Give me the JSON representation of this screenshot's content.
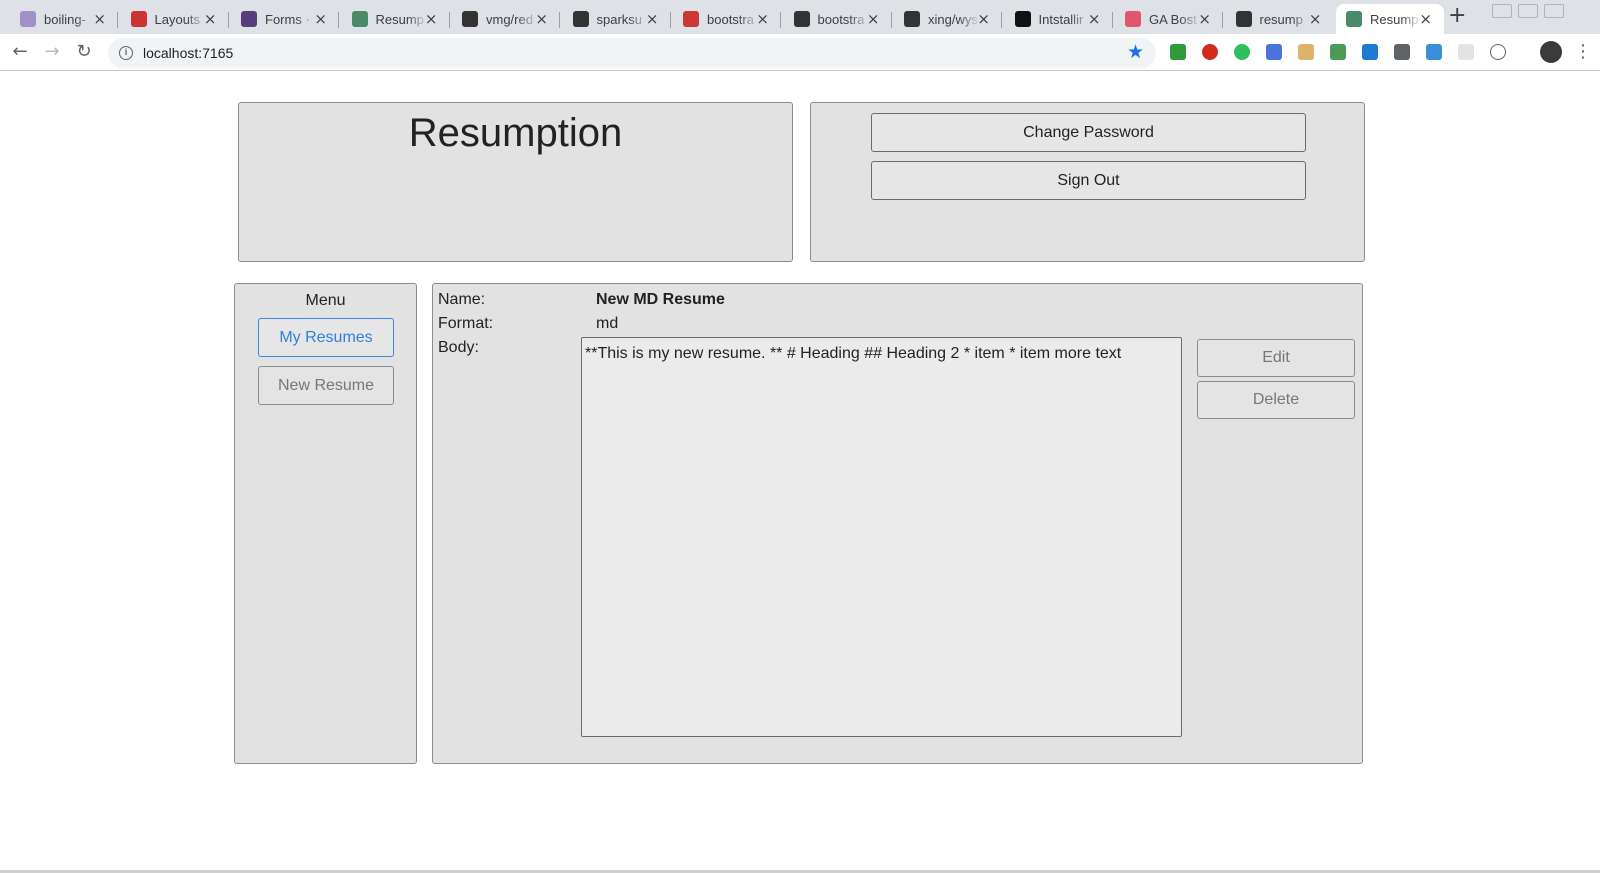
{
  "browser": {
    "tabs": [
      {
        "title": "boiling-",
        "favicon": "heroku-icon",
        "color": "#a18fc9"
      },
      {
        "title": "Layouts",
        "favicon": "rails-icon",
        "color": "#cc3333"
      },
      {
        "title": "Forms ·",
        "favicon": "bootstrap-icon",
        "color": "#563d7c"
      },
      {
        "title": "Resump",
        "favicon": "app-icon",
        "color": "#4a8a6a"
      },
      {
        "title": "vmg/red",
        "favicon": "github-icon",
        "color": "#333333"
      },
      {
        "title": "sparksu",
        "favicon": "github-icon",
        "color": "#333333"
      },
      {
        "title": "bootstra",
        "favicon": "npm-icon",
        "color": "#cb3837"
      },
      {
        "title": "bootstra",
        "favicon": "github-icon",
        "color": "#333333"
      },
      {
        "title": "xing/wys",
        "favicon": "github-icon",
        "color": "#333333"
      },
      {
        "title": "Intstallir",
        "favicon": "github-icon",
        "color": "#111111"
      },
      {
        "title": "GA Bost",
        "favicon": "ga-icon",
        "color": "#e0566a"
      },
      {
        "title": "resump",
        "favicon": "github-icon",
        "color": "#333333"
      },
      {
        "title": "Resump",
        "favicon": "app-icon",
        "color": "#4a8a6a"
      }
    ],
    "active_tab": 12,
    "url": "localhost:7165"
  },
  "header": {
    "app_title": "Resumption",
    "change_password_label": "Change Password",
    "sign_out_label": "Sign Out"
  },
  "menu": {
    "title": "Menu",
    "my_resumes_label": "My Resumes",
    "new_resume_label": "New Resume"
  },
  "resume": {
    "name_label": "Name:",
    "name_value": "New MD Resume",
    "format_label": "Format:",
    "format_value": "md",
    "body_label": "Body:",
    "body_value": "**This is my new resume. ** # Heading ## Heading 2 * item * item more text",
    "edit_label": "Edit",
    "delete_label": "Delete"
  }
}
